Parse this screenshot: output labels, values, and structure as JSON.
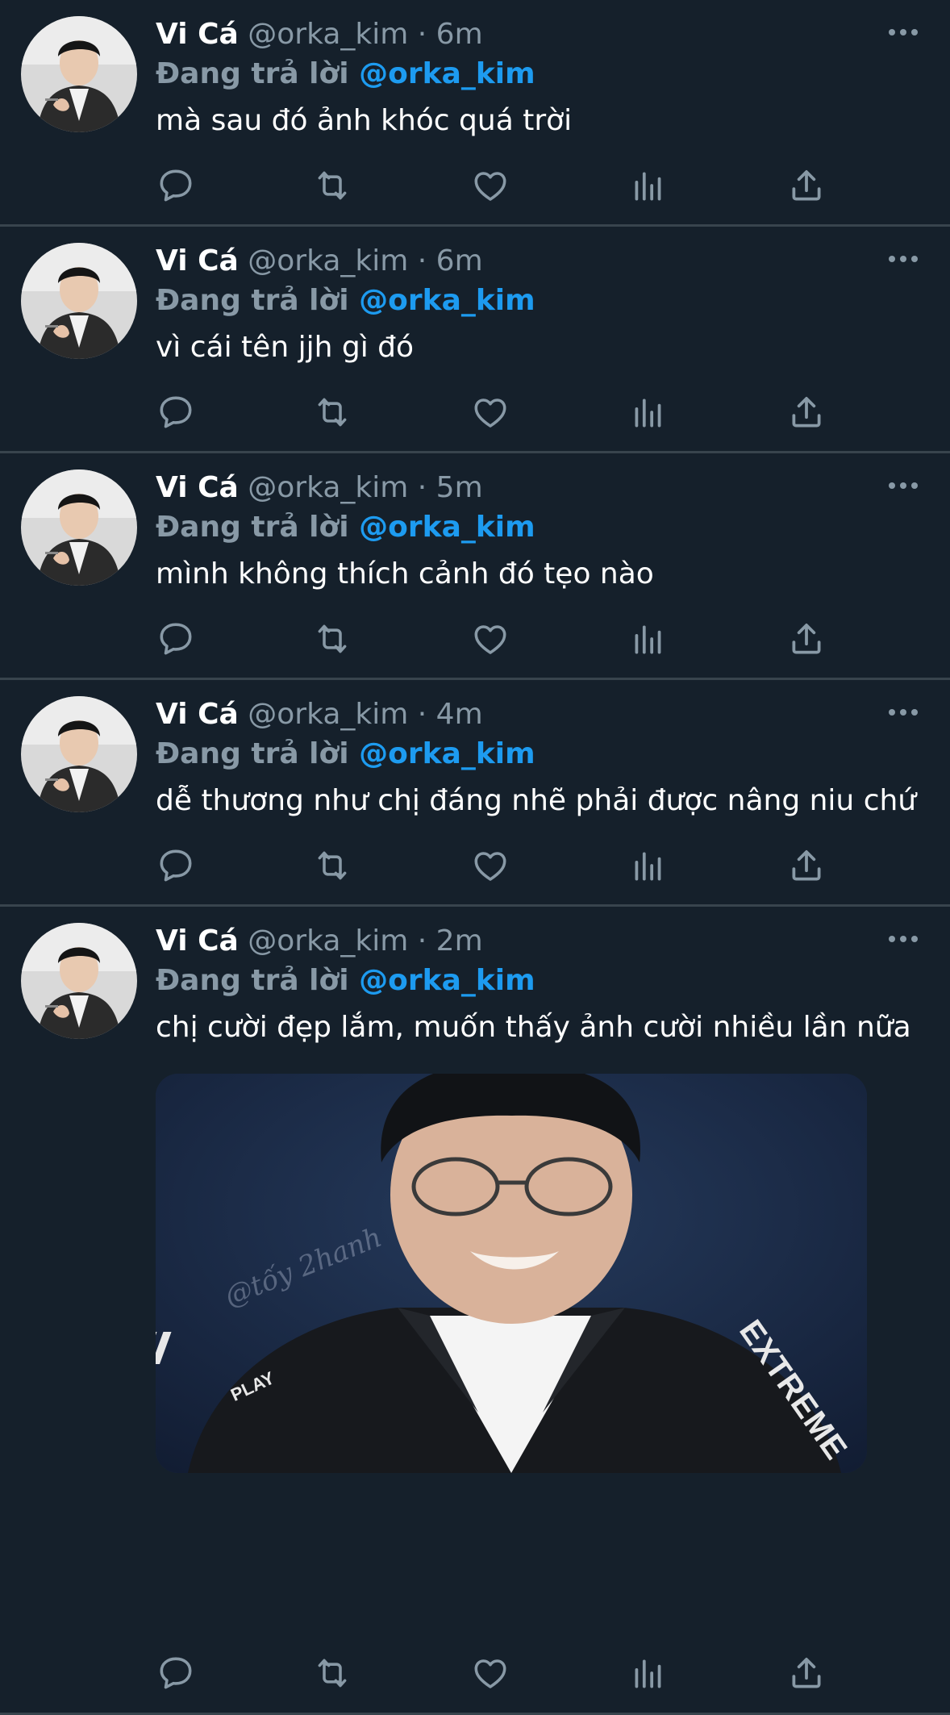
{
  "colors": {
    "background": "#15202b",
    "divider": "#38444d",
    "secondary_text": "#8899a6",
    "mention": "#1d9bf0"
  },
  "tweets": [
    {
      "display_name": "Vi Cá",
      "handle": "@orka_kim",
      "separator": "·",
      "time": "6m",
      "reply_prefix": "Đang trả lời",
      "reply_to": "@orka_kim",
      "text": "mà sau đó ảnh khóc quá trời"
    },
    {
      "display_name": "Vi Cá",
      "handle": "@orka_kim",
      "separator": "·",
      "time": "6m",
      "reply_prefix": "Đang trả lời",
      "reply_to": "@orka_kim",
      "text": "vì cái tên jjh gì đó"
    },
    {
      "display_name": "Vi Cá",
      "handle": "@orka_kim",
      "separator": "·",
      "time": "5m",
      "reply_prefix": "Đang trả lời",
      "reply_to": "@orka_kim",
      "text": "mình không thích cảnh đó tẹo nào"
    },
    {
      "display_name": "Vi Cá",
      "handle": "@orka_kim",
      "separator": "·",
      "time": "4m",
      "reply_prefix": "Đang trả lời",
      "reply_to": "@orka_kim",
      "text": "dễ thương như chị đáng nhẽ phải được nâng niu chứ"
    },
    {
      "display_name": "Vi Cá",
      "handle": "@orka_kim",
      "separator": "·",
      "time": "2m",
      "reply_prefix": "Đang trả lời",
      "reply_to": "@orka_kim",
      "text": "chị cười đẹp lắm, muốn thấy ảnh cười nhiều lần nữa",
      "media": {
        "watermark": "@tốy 2hanh",
        "jacket_logo_left": "PLAY",
        "jacket_logo_right": "EXTREME"
      }
    }
  ],
  "action_icons": [
    "reply-icon",
    "retweet-icon",
    "like-icon",
    "analytics-icon",
    "share-icon"
  ],
  "more_icon": "more-options-icon"
}
